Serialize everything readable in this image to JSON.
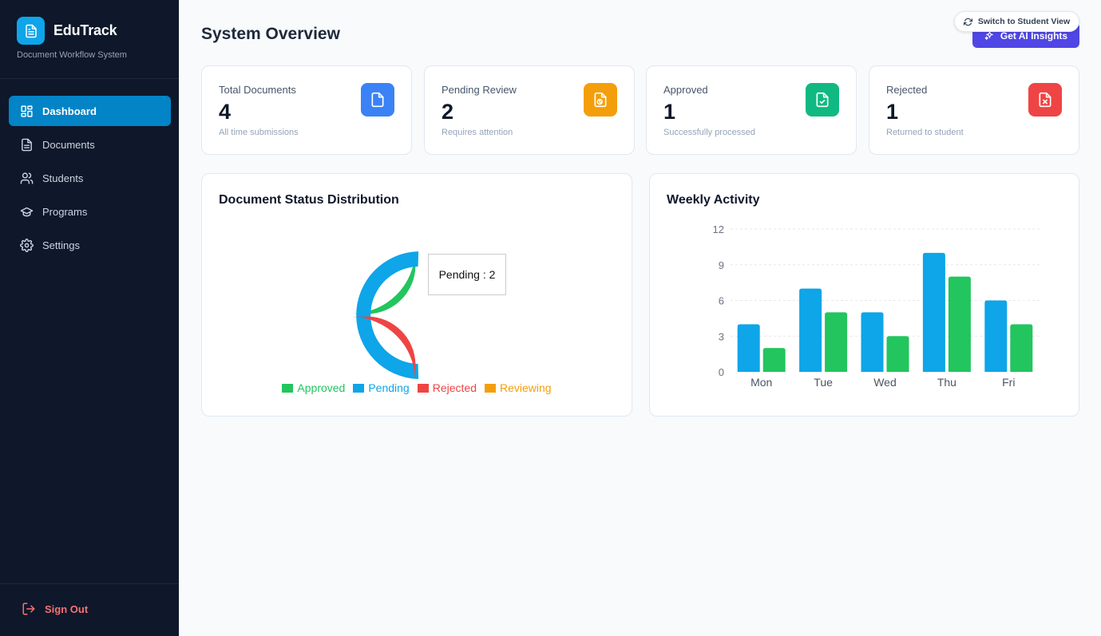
{
  "app": {
    "name": "EduTrack",
    "subtitle": "Document Workflow System"
  },
  "sidebar": {
    "items": [
      {
        "label": "Dashboard",
        "icon": "dashboard-icon",
        "active": true
      },
      {
        "label": "Documents",
        "icon": "document-icon",
        "active": false
      },
      {
        "label": "Students",
        "icon": "users-icon",
        "active": false
      },
      {
        "label": "Programs",
        "icon": "graduation-cap-icon",
        "active": false
      },
      {
        "label": "Settings",
        "icon": "gear-icon",
        "active": false
      }
    ],
    "signout_label": "Sign Out"
  },
  "header": {
    "title": "System Overview",
    "ai_button_label": "Get AI Insights",
    "switch_button_label": "Switch to Student View"
  },
  "stats": [
    {
      "label": "Total Documents",
      "value": "4",
      "sub": "All time submissions",
      "color": "#3b82f6",
      "icon": "file-icon"
    },
    {
      "label": "Pending Review",
      "value": "2",
      "sub": "Requires attention",
      "color": "#f59e0b",
      "icon": "file-clock-icon"
    },
    {
      "label": "Approved",
      "value": "1",
      "sub": "Successfully processed",
      "color": "#10b981",
      "icon": "file-check-icon"
    },
    {
      "label": "Rejected",
      "value": "1",
      "sub": "Returned to student",
      "color": "#ef4444",
      "icon": "file-x-icon"
    }
  ],
  "status_chart": {
    "title": "Document Status Distribution",
    "tooltip": "Pending : 2",
    "chart_data": {
      "type": "pie",
      "categories": [
        "Approved",
        "Pending",
        "Rejected",
        "Reviewing"
      ],
      "values": [
        1,
        2,
        1,
        0
      ],
      "colors": [
        "#22c55e",
        "#0ea5e9",
        "#ef4444",
        "#f59e0b"
      ]
    }
  },
  "weekly_chart": {
    "title": "Weekly Activity",
    "chart_data": {
      "type": "bar",
      "categories": [
        "Mon",
        "Tue",
        "Wed",
        "Thu",
        "Fri"
      ],
      "series": [
        {
          "values": [
            4,
            7,
            5,
            10,
            6
          ],
          "color": "#0ea5e9"
        },
        {
          "values": [
            2,
            5,
            3,
            8,
            4
          ],
          "color": "#22c55e"
        }
      ],
      "yticks": [
        0,
        3,
        6,
        9,
        12
      ],
      "ylim": [
        0,
        12
      ],
      "grid": true
    }
  }
}
